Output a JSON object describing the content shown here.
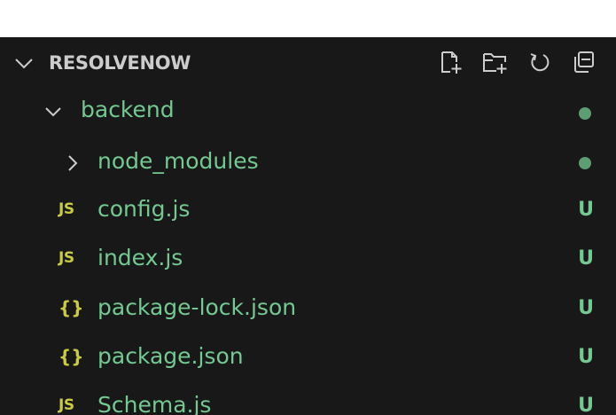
{
  "explorer": {
    "project_name": "RESOLVENOW",
    "actions": [
      {
        "icon": "new-file-icon"
      },
      {
        "icon": "new-folder-icon"
      },
      {
        "icon": "refresh-icon"
      },
      {
        "icon": "collapse-all-icon"
      }
    ]
  },
  "tree": {
    "backend": {
      "label": "backend",
      "icon": "chevron-down-icon"
    },
    "node_modules": {
      "label": "node_modules",
      "icon": "chevron-right-icon"
    },
    "files": [
      {
        "label": "config.js",
        "icon_text": "JS",
        "status": "U"
      },
      {
        "label": "index.js",
        "icon_text": "JS",
        "status": "U"
      },
      {
        "label": "package-lock.json",
        "icon_text": "{}",
        "status": "U"
      },
      {
        "label": "package.json",
        "icon_text": "{}",
        "status": "U"
      },
      {
        "label": "Schema.js",
        "icon_text": "JS",
        "status": "U"
      }
    ]
  },
  "colors": {
    "background": "#181818",
    "untracked_text": "#73c991",
    "js_icon": "#cbcb41",
    "json_icon": "#cbcb41",
    "header_text": "#cccccc",
    "modified_dot": "#73c991"
  }
}
